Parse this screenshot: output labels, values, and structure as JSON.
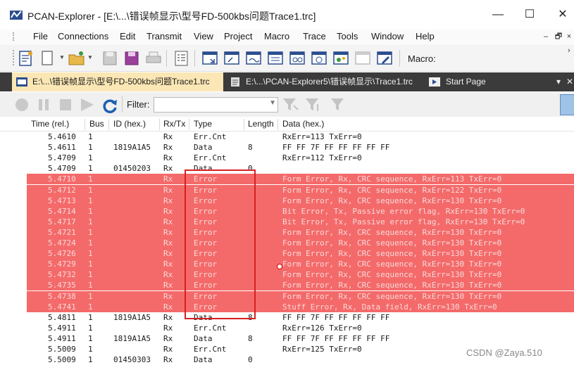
{
  "window": {
    "title": "PCAN-Explorer - [E:\\...\\错误帧显示\\型号FD-500kbs问题Trace1.trc]",
    "minimize": "—",
    "maximize": "☐",
    "close": "✕"
  },
  "menu": {
    "items": [
      "File",
      "Connections",
      "Edit",
      "Transmit",
      "View",
      "Project",
      "Macro",
      "Trace",
      "Tools",
      "Window",
      "Help"
    ],
    "mdi_min": "–",
    "mdi_restore": "🗗",
    "mdi_close": "×"
  },
  "toolbar": {
    "macro_label": "Macro:",
    "more": "›"
  },
  "tabs": [
    {
      "label": "E:\\...\\错误帧显示\\型号FD-500kbs问题Trace1.trc",
      "active": true
    },
    {
      "label": "E:\\...\\PCAN-Explorer5\\错误帧显示\\Trace1.trc",
      "active": false
    },
    {
      "label": "Start Page",
      "active": false
    }
  ],
  "tab_controls": {
    "dropdown": "▾",
    "close": "✕"
  },
  "filter": {
    "label": "Filter:",
    "value": ""
  },
  "table": {
    "columns": [
      "Time (rel.)",
      "Bus",
      "ID (hex.)",
      "Rx/Tx",
      "Type",
      "Length",
      "Data (hex.)"
    ],
    "rows": [
      {
        "time": "5.4610",
        "bus": "1",
        "id": "",
        "dir": "Rx",
        "type": "Err.Cnt",
        "length": "",
        "data": "RxErr=113 TxErr=0",
        "error": false
      },
      {
        "time": "5.4611",
        "bus": "1",
        "id": "1819A1A5",
        "dir": "Rx",
        "type": "Data",
        "length": "8",
        "data": "FF FF 7F FF FF FF FF FF",
        "error": false
      },
      {
        "time": "5.4709",
        "bus": "1",
        "id": "",
        "dir": "Rx",
        "type": "Err.Cnt",
        "length": "",
        "data": "RxErr=112 TxErr=0",
        "error": false
      },
      {
        "time": "5.4709",
        "bus": "1",
        "id": "01450203",
        "dir": "Rx",
        "type": "Data",
        "length": "0",
        "data": "",
        "error": false
      },
      {
        "time": "5.4710",
        "bus": "1",
        "id": "",
        "dir": "Rx",
        "type": "Error",
        "length": "",
        "data": "Form Error, Rx, CRC sequence, RxErr=113 TxErr=0",
        "error": true
      },
      {
        "time": "5.4712",
        "bus": "1",
        "id": "",
        "dir": "Rx",
        "type": "Error",
        "length": "",
        "data": "Form Error, Rx, CRC sequence, RxErr=122 TxErr=0",
        "error": true
      },
      {
        "time": "5.4713",
        "bus": "1",
        "id": "",
        "dir": "Rx",
        "type": "Error",
        "length": "",
        "data": "Form Error, Rx, CRC sequence, RxErr=130 TxErr=0",
        "error": true
      },
      {
        "time": "5.4714",
        "bus": "1",
        "id": "",
        "dir": "Rx",
        "type": "Error",
        "length": "",
        "data": "Bit Error, Tx, Passive error flag, RxErr=130 TxErr=0",
        "error": true
      },
      {
        "time": "5.4717",
        "bus": "1",
        "id": "",
        "dir": "Rx",
        "type": "Error",
        "length": "",
        "data": "Bit Error, Tx, Passive error flag, RxErr=130 TxErr=0",
        "error": true
      },
      {
        "time": "5.4721",
        "bus": "1",
        "id": "",
        "dir": "Rx",
        "type": "Error",
        "length": "",
        "data": "Form Error, Rx, CRC sequence, RxErr=130 TxErr=0",
        "error": true
      },
      {
        "time": "5.4724",
        "bus": "1",
        "id": "",
        "dir": "Rx",
        "type": "Error",
        "length": "",
        "data": "Form Error, Rx, CRC sequence, RxErr=130 TxErr=0",
        "error": true
      },
      {
        "time": "5.4726",
        "bus": "1",
        "id": "",
        "dir": "Rx",
        "type": "Error",
        "length": "",
        "data": "Form Error, Rx, CRC sequence, RxErr=130 TxErr=0",
        "error": true
      },
      {
        "time": "5.4729",
        "bus": "1",
        "id": "",
        "dir": "Rx",
        "type": "Error",
        "length": "",
        "data": "Form Error, Rx, CRC sequence, RxErr=130 TxErr=0",
        "error": true
      },
      {
        "time": "5.4732",
        "bus": "1",
        "id": "",
        "dir": "Rx",
        "type": "Error",
        "length": "",
        "data": "Form Error, Rx, CRC sequence, RxErr=130 TxErr=0",
        "error": true
      },
      {
        "time": "5.4735",
        "bus": "1",
        "id": "",
        "dir": "Rx",
        "type": "Error",
        "length": "",
        "data": "Form Error, Rx, CRC sequence, RxErr=130 TxErr=0",
        "error": true
      },
      {
        "time": "5.4738",
        "bus": "1",
        "id": "",
        "dir": "Rx",
        "type": "Error",
        "length": "",
        "data": "Form Error, Rx, CRC sequence, RxErr=130 TxErr=0",
        "error": true
      },
      {
        "time": "5.4741",
        "bus": "1",
        "id": "",
        "dir": "Rx",
        "type": "Error",
        "length": "",
        "data": "Stuff Error, Rx, Data field, RxErr=130 TxErr=0",
        "error": true
      },
      {
        "time": "5.4811",
        "bus": "1",
        "id": "1819A1A5",
        "dir": "Rx",
        "type": "Data",
        "length": "8",
        "data": "FF FF 7F FF FF FF FF FF",
        "error": false
      },
      {
        "time": "5.4911",
        "bus": "1",
        "id": "",
        "dir": "Rx",
        "type": "Err.Cnt",
        "length": "",
        "data": "RxErr=126 TxErr=0",
        "error": false
      },
      {
        "time": "5.4911",
        "bus": "1",
        "id": "1819A1A5",
        "dir": "Rx",
        "type": "Data",
        "length": "8",
        "data": "FF FF 7F FF FF FF FF FF",
        "error": false
      },
      {
        "time": "5.5009",
        "bus": "1",
        "id": "",
        "dir": "Rx",
        "type": "Err.Cnt",
        "length": "",
        "data": "RxErr=125 TxErr=0",
        "error": false
      },
      {
        "time": "5.5009",
        "bus": "1",
        "id": "01450303",
        "dir": "Rx",
        "type": "Data",
        "length": "0",
        "data": "",
        "error": false
      }
    ]
  },
  "watermark": "CSDN @Zaya.510",
  "colors": {
    "error_row": "#f46a6a",
    "annotation": "#d62020",
    "tab_active": "#fbe7b5"
  }
}
